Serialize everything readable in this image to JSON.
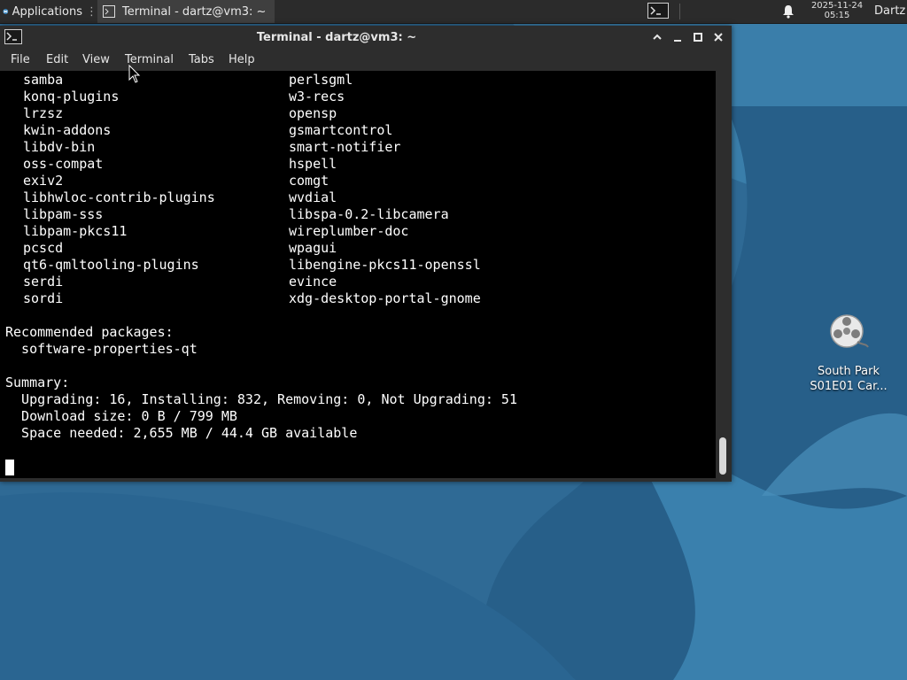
{
  "panel": {
    "applications_label": "Applications",
    "task_label": "Terminal - dartz@vm3: ~",
    "clock_date": "2025-11-24",
    "clock_time": "05:15",
    "user": "Dartz",
    "apps_icon": "xfce-icon",
    "terminal_icon": "terminal-icon",
    "bell_icon": "bell-icon"
  },
  "window": {
    "title": "Terminal - dartz@vm3: ~",
    "menu": [
      "File",
      "Edit",
      "View",
      "Terminal",
      "Tabs",
      "Help"
    ],
    "controls": [
      "chevron-up-icon",
      "minimize-icon",
      "maximize-icon",
      "close-icon"
    ]
  },
  "terminal": {
    "pkg_rows": [
      [
        "samba",
        "perlsgml"
      ],
      [
        "konq-plugins",
        "w3-recs"
      ],
      [
        "lrzsz",
        "opensp"
      ],
      [
        "kwin-addons",
        "gsmartcontrol"
      ],
      [
        "libdv-bin",
        "smart-notifier"
      ],
      [
        "oss-compat",
        "hspell"
      ],
      [
        "exiv2",
        "comgt"
      ],
      [
        "libhwloc-contrib-plugins",
        "wvdial"
      ],
      [
        "libpam-sss",
        "libspa-0.2-libcamera"
      ],
      [
        "libpam-pkcs11",
        "wireplumber-doc"
      ],
      [
        "pcscd",
        "wpagui"
      ],
      [
        "qt6-qmltooling-plugins",
        "libengine-pkcs11-openssl"
      ],
      [
        "serdi",
        "evince"
      ],
      [
        "sordi",
        "xdg-desktop-portal-gnome"
      ]
    ],
    "recommended_header": "Recommended packages:",
    "recommended_item": "  software-properties-qt",
    "summary_header": "Summary:",
    "summary_lines": [
      "  Upgrading: 16, Installing: 832, Removing: 0, Not Upgrading: 51",
      "  Download size: 0 B / 799 MB",
      "  Space needed: 2,655 MB / 44.4 GB available"
    ]
  },
  "desktop": {
    "icon_label_line1": "South Park",
    "icon_label_line2": "S01E01 Car...",
    "icon_name": "video-reel-icon"
  },
  "colors": {
    "panel_bg": "#2b2b2b",
    "window_bg": "#2d2d2d",
    "terminal_bg": "#000000",
    "terminal_fg": "#ffffff",
    "desktop_blue": "#2f6a95"
  }
}
